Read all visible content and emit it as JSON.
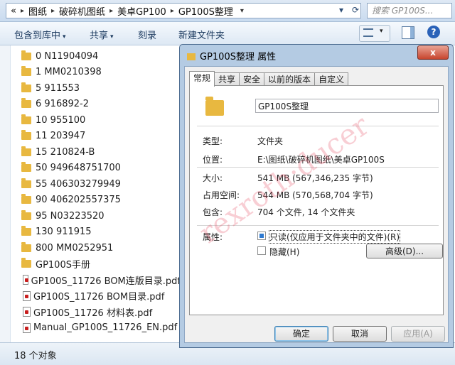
{
  "address_bar": {
    "breadcrumbs": [
      "«",
      "图纸",
      "破碎机图纸",
      "美卓GP100",
      "GP100S整理"
    ],
    "search_placeholder": "搜索 GP100S..."
  },
  "toolbar": {
    "items": [
      "包含到库中",
      "共享",
      "刻录",
      "新建文件夹"
    ],
    "help": "?"
  },
  "file_list": [
    {
      "name": "0  N11904094",
      "type": "folder"
    },
    {
      "name": "1  MM0210398",
      "type": "folder"
    },
    {
      "name": "5  911553",
      "type": "folder"
    },
    {
      "name": "6  916892-2",
      "type": "folder"
    },
    {
      "name": "10  955100",
      "type": "folder"
    },
    {
      "name": "11  203947",
      "type": "folder"
    },
    {
      "name": "15  210824-B",
      "type": "folder"
    },
    {
      "name": "50  949648751700",
      "type": "folder"
    },
    {
      "name": "55  406303279949",
      "type": "folder"
    },
    {
      "name": "90  406202557375",
      "type": "folder"
    },
    {
      "name": "95  N03223520",
      "type": "folder"
    },
    {
      "name": "130 911915",
      "type": "folder"
    },
    {
      "name": "800 MM0252951",
      "type": "folder"
    },
    {
      "name": "GP100S手册",
      "type": "folder"
    },
    {
      "name": "GP100S_11726  BOM连版目录.pdf",
      "type": "pdf"
    },
    {
      "name": "GP100S_11726  BOM目录.pdf",
      "type": "pdf"
    },
    {
      "name": "GP100S_11726  材料表.pdf",
      "type": "pdf"
    },
    {
      "name": "Manual_GP100S_11726_EN.pdf",
      "type": "pdf"
    }
  ],
  "status_bar": {
    "text": "18 个对象"
  },
  "dialog": {
    "title": "GP100S整理 属性",
    "close": "x",
    "tabs": [
      "常规",
      "共享",
      "安全",
      "以前的版本",
      "自定义"
    ],
    "active_tab": "常规",
    "folder_name": "GP100S整理",
    "properties": [
      {
        "label": "类型:",
        "value": "文件夹"
      },
      {
        "label": "位置:",
        "value": "E:\\图纸\\破碎机图纸\\美卓GP100S"
      },
      {
        "label": "大小:",
        "value": "541 MB (567,346,235 字节)"
      },
      {
        "label": "占用空间:",
        "value": "544 MB (570,568,704 字节)"
      },
      {
        "label": "包含:",
        "value": "704 个文件, 14 个文件夹"
      }
    ],
    "attributes_label": "属性:",
    "readonly_label": "只读(仅应用于文件夹中的文件)(R)",
    "hidden_label": "隐藏(H)",
    "advanced_button": "高级(D)...",
    "ok_button": "确定",
    "cancel_button": "取消",
    "apply_button": "应用(A)"
  },
  "watermark": "rexroth·ducer"
}
